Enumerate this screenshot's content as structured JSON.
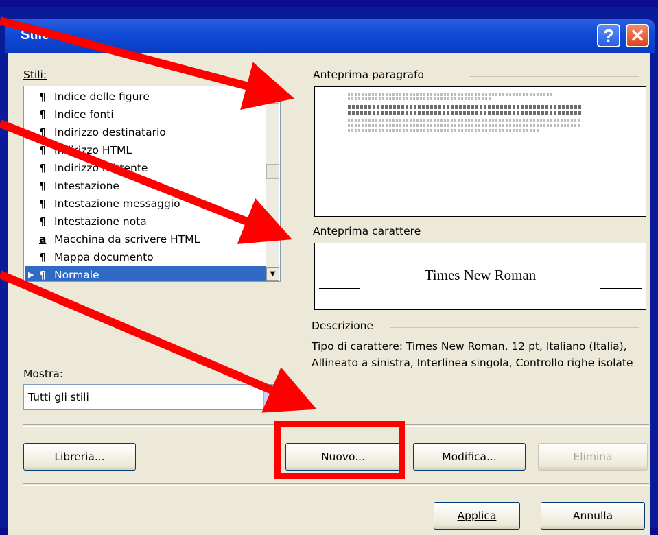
{
  "window": {
    "title": "Stile",
    "help_icon": "help-icon",
    "close_icon": "close-icon"
  },
  "styles_panel": {
    "label": "Stili:",
    "items": [
      {
        "glyph": "¶",
        "label": "Indice delle figure"
      },
      {
        "glyph": "¶",
        "label": "Indice fonti"
      },
      {
        "glyph": "¶",
        "label": "Indirizzo destinatario"
      },
      {
        "glyph": "¶",
        "label": "Indirizzo HTML"
      },
      {
        "glyph": "¶",
        "label": "Indirizzo mittente"
      },
      {
        "glyph": "¶",
        "label": "Intestazione"
      },
      {
        "glyph": "¶",
        "label": "Intestazione messaggio"
      },
      {
        "glyph": "¶",
        "label": "Intestazione nota"
      },
      {
        "glyph": "a",
        "label": "Macchina da scrivere HTML"
      },
      {
        "glyph": "¶",
        "label": "Mappa documento"
      },
      {
        "glyph": "¶",
        "label": "Normale",
        "selected": true
      }
    ]
  },
  "paragraph_preview": {
    "label": "Anteprima paragrafo"
  },
  "char_preview": {
    "label": "Anteprima carattere",
    "sample": "Times New Roman"
  },
  "description": {
    "label": "Descrizione",
    "text": "Tipo di carattere: Times New Roman, 12 pt, Italiano (Italia), Allineato a sinistra, Interlinea singola, Controllo righe isolate"
  },
  "show": {
    "label": "Mostra:",
    "value": "Tutti gli stili"
  },
  "buttons": {
    "library": "Libreria...",
    "new": "Nuovo...",
    "modify": "Modifica...",
    "delete": "Elimina",
    "apply": "Applica",
    "cancel": "Annulla"
  },
  "colors": {
    "selection": "#316ac5",
    "titlebar": "#0a3cc3",
    "annotation": "#ff0000"
  }
}
